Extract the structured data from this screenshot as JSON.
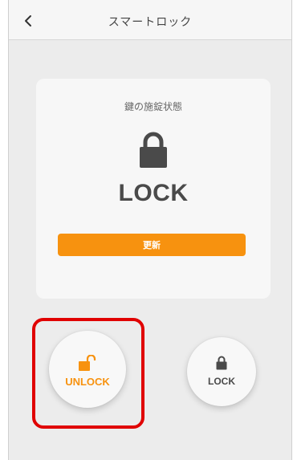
{
  "header": {
    "back_icon": "chevron-left-icon",
    "title": "スマートロック"
  },
  "status_card": {
    "label": "鍵の施錠状態",
    "icon": "padlock-closed-icon",
    "status": "LOCK",
    "refresh_label": "更新"
  },
  "actions": {
    "unlock": {
      "label": "UNLOCK",
      "icon": "padlock-open-icon",
      "color": "#f7920f"
    },
    "lock": {
      "label": "LOCK",
      "icon": "padlock-closed-icon",
      "color": "#4a4a4a"
    }
  },
  "colors": {
    "accent": "#f7920f",
    "highlight": "#e00000",
    "background": "#ececec"
  }
}
